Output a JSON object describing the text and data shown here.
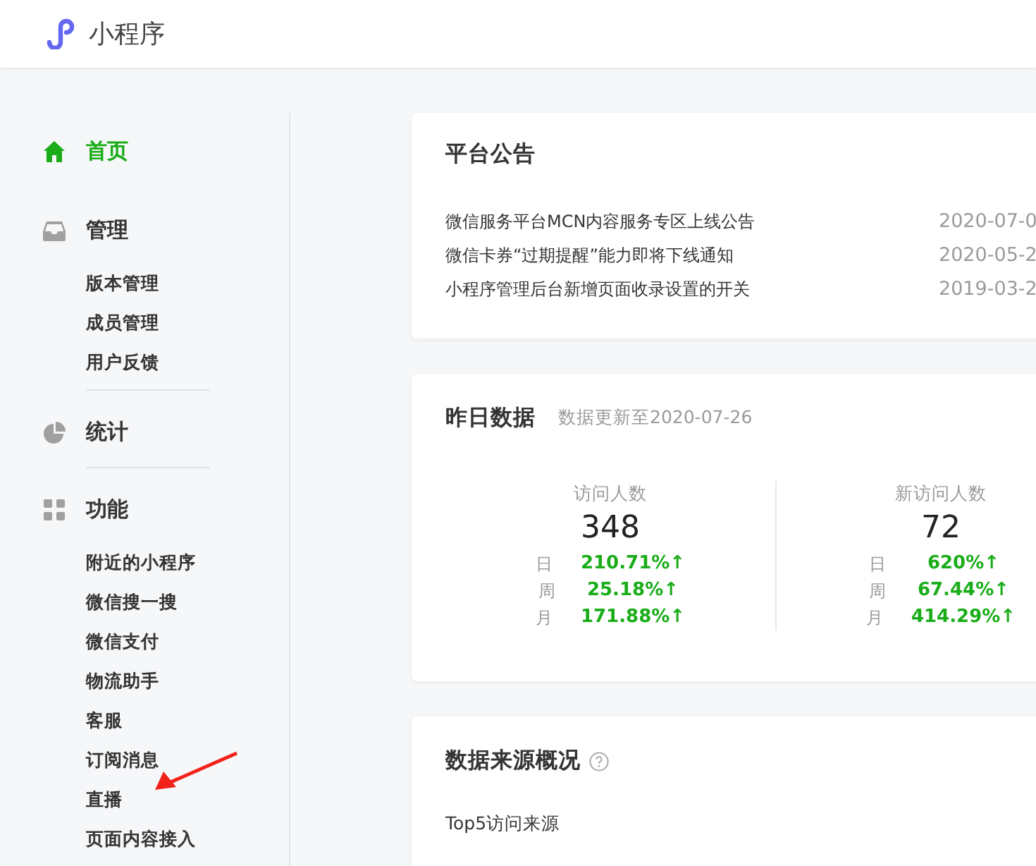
{
  "header": {
    "title": "小程序"
  },
  "sidebar": {
    "groups": [
      {
        "title": "首页",
        "selected": true,
        "divider": false
      },
      {
        "title": "管理",
        "selected": false,
        "divider": true,
        "children": [
          {
            "label": "版本管理"
          },
          {
            "label": "成员管理"
          },
          {
            "label": "用户反馈"
          }
        ]
      },
      {
        "title": "统计",
        "selected": false,
        "divider": true
      },
      {
        "title": "功能",
        "selected": false,
        "divider": false,
        "children": [
          {
            "label": "附近的小程序"
          },
          {
            "label": "微信搜一搜"
          },
          {
            "label": "微信支付"
          },
          {
            "label": "物流助手"
          },
          {
            "label": "客服"
          },
          {
            "label": "订阅消息"
          },
          {
            "label": "直播"
          },
          {
            "label": "页面内容接入"
          }
        ]
      }
    ]
  },
  "announcements": {
    "title": "平台公告",
    "items": [
      {
        "title": "微信服务平台MCN内容服务专区上线公告",
        "date": "2020-07-0"
      },
      {
        "title": "微信卡券“过期提醒”能力即将下线通知",
        "date": "2020-05-2"
      },
      {
        "title": "小程序管理后台新增页面收录设置的开关",
        "date": "2019-03-2"
      }
    ]
  },
  "yesterday": {
    "title": "昨日数据",
    "subtitle": "数据更新至2020-07-26",
    "stats": [
      {
        "label": "访问人数",
        "value": "348",
        "changes": [
          {
            "period": "日",
            "value": "210.71%↑"
          },
          {
            "period": "周",
            "value": "25.18%↑"
          },
          {
            "period": "月",
            "value": "171.88%↑"
          }
        ]
      },
      {
        "label": "新访问人数",
        "value": "72",
        "changes": [
          {
            "period": "日",
            "value": "620%↑"
          },
          {
            "period": "周",
            "value": "67.44%↑"
          },
          {
            "period": "月",
            "value": "414.29%↑"
          }
        ]
      }
    ]
  },
  "sources": {
    "title": "数据来源概况",
    "subtitle": "Top5访问来源"
  }
}
